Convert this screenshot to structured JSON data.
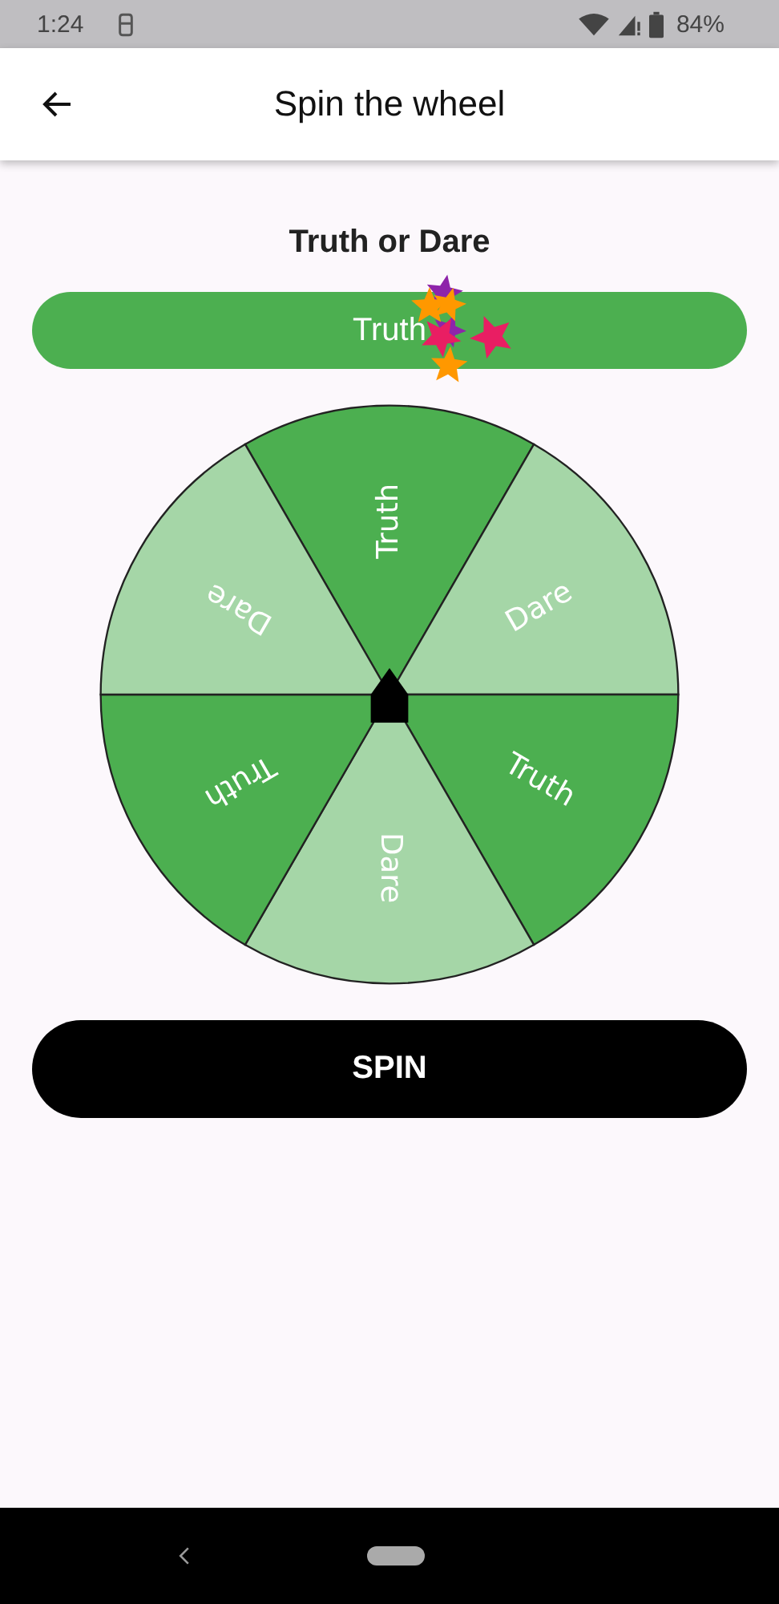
{
  "status_bar": {
    "time": "1:24",
    "battery": "84%"
  },
  "app_bar": {
    "title": "Spin the wheel"
  },
  "game_title": "Truth or Dare",
  "result": {
    "label": "Truth"
  },
  "wheel": {
    "segments": [
      {
        "label": "Truth",
        "color": "#4caf50"
      },
      {
        "label": "Dare",
        "color": "#a5d6a7"
      },
      {
        "label": "Truth",
        "color": "#4caf50"
      },
      {
        "label": "Dare",
        "color": "#a5d6a7"
      },
      {
        "label": "Truth",
        "color": "#4caf50"
      },
      {
        "label": "Dare",
        "color": "#a5d6a7"
      }
    ]
  },
  "spin_button": {
    "label": "SPIN"
  }
}
